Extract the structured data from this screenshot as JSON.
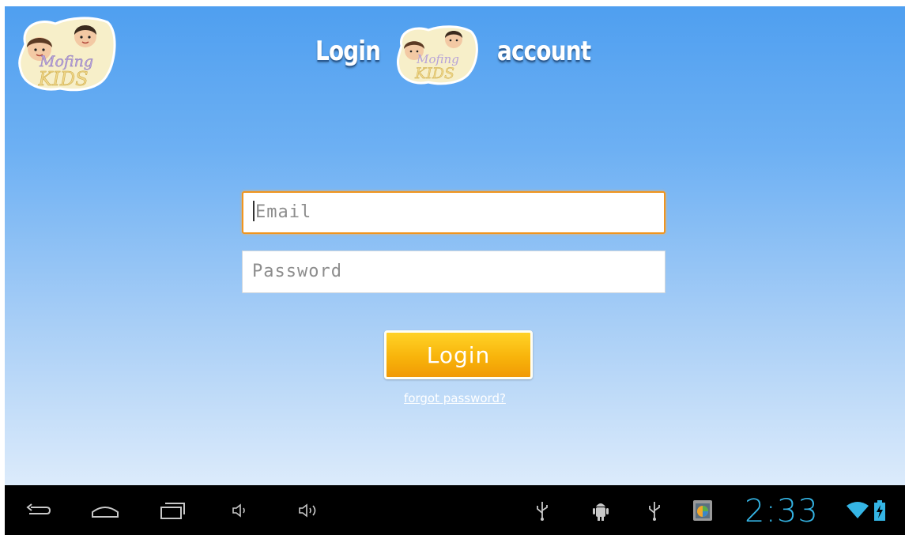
{
  "header": {
    "title_before": "Login",
    "title_after": "account",
    "logo_text_top": "Mofing",
    "logo_text_bottom": "KIDS"
  },
  "form": {
    "email": {
      "placeholder": "Email",
      "value": "",
      "focused": true
    },
    "password": {
      "placeholder": "Password",
      "value": ""
    },
    "login_label": "Login",
    "forgot_label": "forgot password?"
  },
  "navbar": {
    "buttons": [
      "back-icon",
      "home-icon",
      "recent-apps-icon",
      "volume-down-icon",
      "volume-up-icon"
    ],
    "status_icons": [
      "usb-icon",
      "android-debug-icon",
      "usb-icon",
      "gallery-notification-icon"
    ],
    "time": "2:33",
    "wifi": "wifi-full-icon",
    "battery": "battery-charging-icon"
  },
  "colors": {
    "accent_orange": "#f0951f",
    "button_yellow": "#f8b40b",
    "clock_blue": "#35b5e5",
    "sky_top": "#4f9ff0",
    "sky_bottom": "#dcebfb"
  }
}
